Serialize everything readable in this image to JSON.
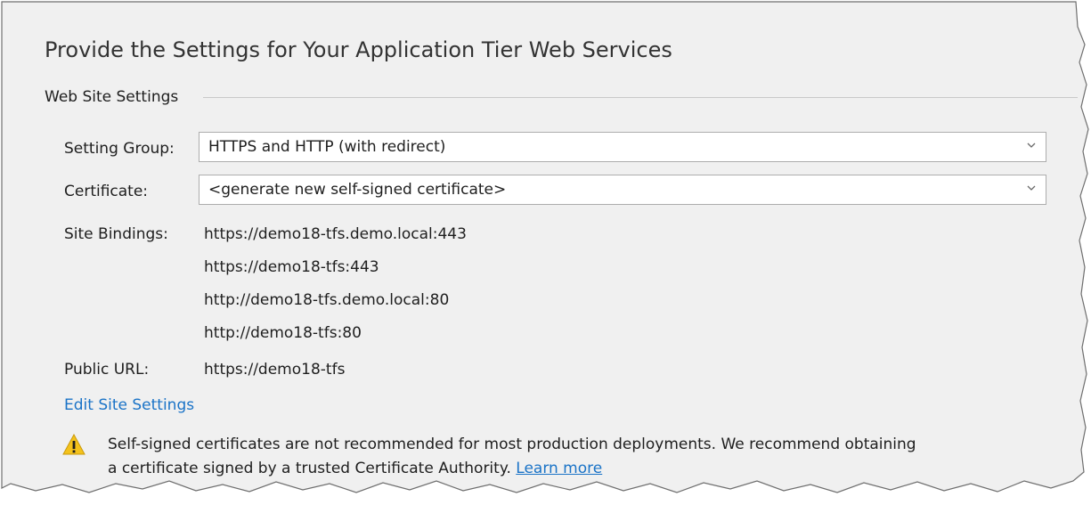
{
  "page_title": "Provide the Settings for Your Application Tier Web Services",
  "web_site_settings": {
    "group_label": "Web Site Settings",
    "setting_group": {
      "label": "Setting Group:",
      "value": "HTTPS and HTTP (with redirect)"
    },
    "certificate": {
      "label": "Certificate:",
      "value": "<generate new self-signed certificate>"
    },
    "site_bindings": {
      "label": "Site Bindings:",
      "items": [
        "https://demo18-tfs.demo.local:443",
        "https://demo18-tfs:443",
        "http://demo18-tfs.demo.local:80",
        "http://demo18-tfs:80"
      ]
    },
    "public_url": {
      "label": "Public URL:",
      "value": "https://demo18-tfs"
    },
    "edit_link": "Edit Site Settings"
  },
  "warning": {
    "icon": "warning-icon",
    "line1": "Self-signed certificates are not recommended for most production deployments. We recommend obtaining",
    "line2": "a certificate signed by a trusted Certificate Authority.",
    "link": "Learn more"
  },
  "colors": {
    "link": "#1a73c7",
    "warning_fill": "#f4c21b",
    "border": "#adadad"
  }
}
